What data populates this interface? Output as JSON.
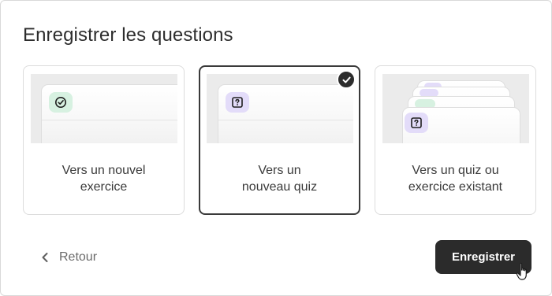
{
  "dialog": {
    "title": "Enregistrer les questions"
  },
  "options": [
    {
      "line1": "Vers un nouvel",
      "line2": "exercice",
      "icon": "check-circle-icon",
      "badge_color": "#d7f1e1",
      "selected": false
    },
    {
      "line1": "Vers un",
      "line2": "nouveau quiz",
      "icon": "question-square-icon",
      "badge_color": "#e3dcf9",
      "selected": true
    },
    {
      "line1": "Vers un quiz ou",
      "line2": "exercice existant",
      "icon": "question-square-icon",
      "badge_color": "#e3dcf9",
      "selected": false
    }
  ],
  "footer": {
    "back_label": "Retour",
    "save_label": "Enregistrer"
  },
  "colors": {
    "primary": "#2b2b2b",
    "exercise_badge": "#d7f1e1",
    "quiz_badge": "#e3dcf9"
  }
}
